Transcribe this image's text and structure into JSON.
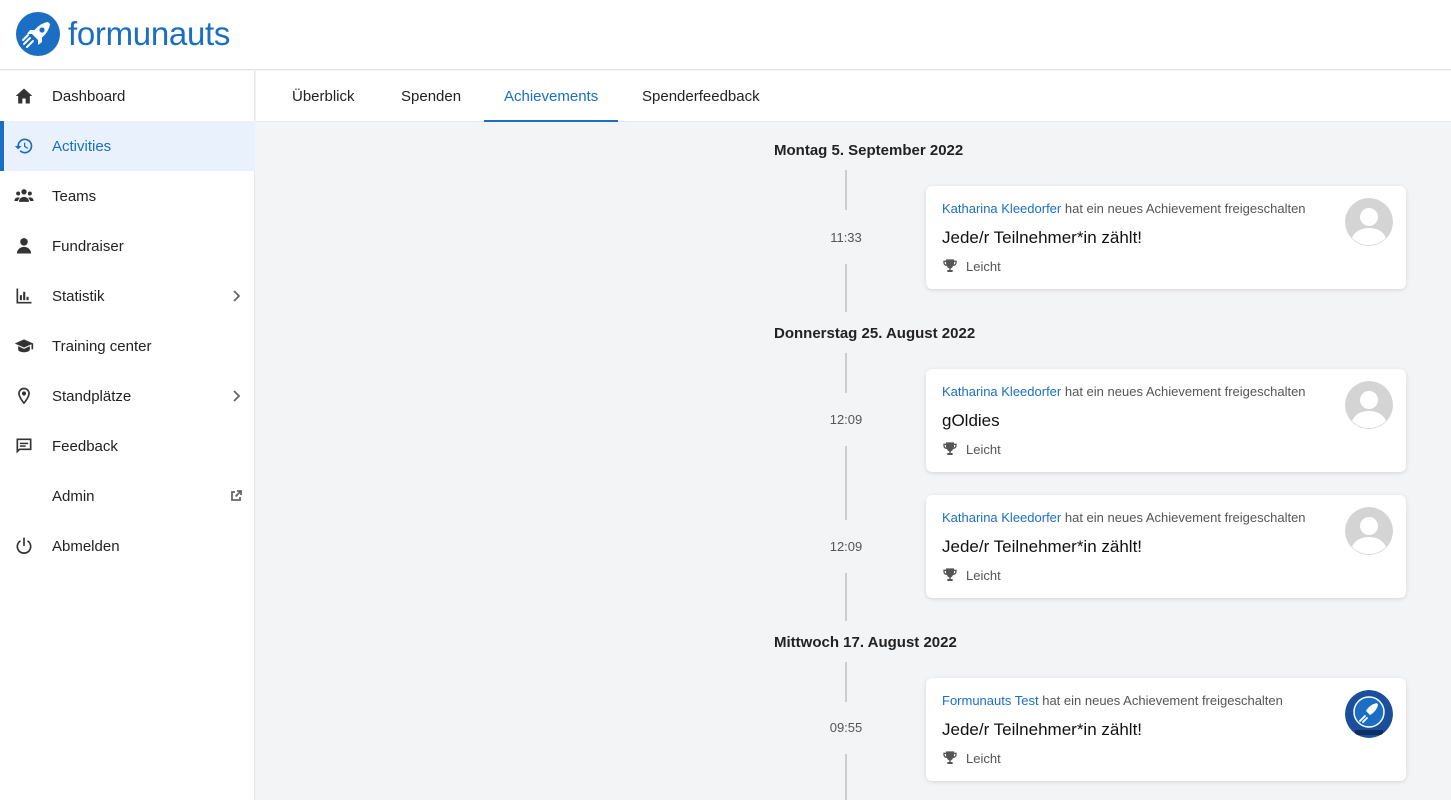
{
  "brand": {
    "name": "formunauts",
    "color": "#1a6fc4",
    "icon": "rocket-logo-icon"
  },
  "sidebar": {
    "items": [
      {
        "label": "Dashboard",
        "icon": "home-icon"
      },
      {
        "label": "Activities",
        "icon": "history-icon",
        "active": true
      },
      {
        "label": "Teams",
        "icon": "users-icon"
      },
      {
        "label": "Fundraiser",
        "icon": "user-icon"
      },
      {
        "label": "Statistik",
        "icon": "bar-chart-icon",
        "trail": "chevron-right-icon"
      },
      {
        "label": "Training center",
        "icon": "graduation-cap-icon"
      },
      {
        "label": "Standplätze",
        "icon": "map-pin-icon",
        "trail": "chevron-right-icon"
      },
      {
        "label": "Feedback",
        "icon": "message-icon"
      },
      {
        "label": "Admin",
        "trail": "external-link-icon"
      },
      {
        "label": "Abmelden",
        "icon": "power-icon"
      }
    ]
  },
  "tabs": [
    {
      "label": "Überblick"
    },
    {
      "label": "Spenden"
    },
    {
      "label": "Achievements",
      "active": true
    },
    {
      "label": "Spenderfeedback"
    }
  ],
  "timeline": {
    "groups": [
      {
        "date": "Montag 5. September 2022",
        "entries": [
          {
            "time": "11:33",
            "user": "Katharina Kleedorfer",
            "action": "hat ein neues Achievement freigeschalten",
            "title": "Jede/r Teilnehmer*in zählt!",
            "level": "Leicht",
            "avatar": "default-avatar-icon"
          }
        ]
      },
      {
        "date": "Donnerstag 25. August 2022",
        "entries": [
          {
            "time": "12:09",
            "user": "Katharina Kleedorfer",
            "action": "hat ein neues Achievement freigeschalten",
            "title": "gOldies",
            "level": "Leicht",
            "avatar": "default-avatar-icon"
          },
          {
            "time": "12:09",
            "user": "Katharina Kleedorfer",
            "action": "hat ein neues Achievement freigeschalten",
            "title": "Jede/r Teilnehmer*in zählt!",
            "level": "Leicht",
            "avatar": "default-avatar-icon"
          }
        ]
      },
      {
        "date": "Mittwoch 17. August 2022",
        "entries": [
          {
            "time": "09:55",
            "user": "Formunauts Test",
            "action": "hat ein neues Achievement freigeschalten",
            "title": "Jede/r Teilnehmer*in zählt!",
            "level": "Leicht",
            "avatar": "formunauts-avatar-icon"
          }
        ]
      }
    ]
  },
  "colors": {
    "accent": "#1a6fc4",
    "active_bg": "#e8f1fc",
    "background": "#f3f4f6"
  }
}
